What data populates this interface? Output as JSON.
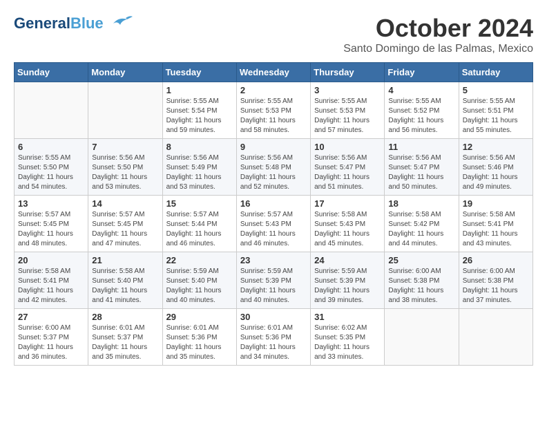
{
  "header": {
    "logo_line1": "General",
    "logo_line2": "Blue",
    "month_year": "October 2024",
    "location": "Santo Domingo de las Palmas, Mexico"
  },
  "weekdays": [
    "Sunday",
    "Monday",
    "Tuesday",
    "Wednesday",
    "Thursday",
    "Friday",
    "Saturday"
  ],
  "weeks": [
    [
      {
        "day": "",
        "info": ""
      },
      {
        "day": "",
        "info": ""
      },
      {
        "day": "1",
        "info": "Sunrise: 5:55 AM\nSunset: 5:54 PM\nDaylight: 11 hours\nand 59 minutes."
      },
      {
        "day": "2",
        "info": "Sunrise: 5:55 AM\nSunset: 5:53 PM\nDaylight: 11 hours\nand 58 minutes."
      },
      {
        "day": "3",
        "info": "Sunrise: 5:55 AM\nSunset: 5:53 PM\nDaylight: 11 hours\nand 57 minutes."
      },
      {
        "day": "4",
        "info": "Sunrise: 5:55 AM\nSunset: 5:52 PM\nDaylight: 11 hours\nand 56 minutes."
      },
      {
        "day": "5",
        "info": "Sunrise: 5:55 AM\nSunset: 5:51 PM\nDaylight: 11 hours\nand 55 minutes."
      }
    ],
    [
      {
        "day": "6",
        "info": "Sunrise: 5:55 AM\nSunset: 5:50 PM\nDaylight: 11 hours\nand 54 minutes."
      },
      {
        "day": "7",
        "info": "Sunrise: 5:56 AM\nSunset: 5:50 PM\nDaylight: 11 hours\nand 53 minutes."
      },
      {
        "day": "8",
        "info": "Sunrise: 5:56 AM\nSunset: 5:49 PM\nDaylight: 11 hours\nand 53 minutes."
      },
      {
        "day": "9",
        "info": "Sunrise: 5:56 AM\nSunset: 5:48 PM\nDaylight: 11 hours\nand 52 minutes."
      },
      {
        "day": "10",
        "info": "Sunrise: 5:56 AM\nSunset: 5:47 PM\nDaylight: 11 hours\nand 51 minutes."
      },
      {
        "day": "11",
        "info": "Sunrise: 5:56 AM\nSunset: 5:47 PM\nDaylight: 11 hours\nand 50 minutes."
      },
      {
        "day": "12",
        "info": "Sunrise: 5:56 AM\nSunset: 5:46 PM\nDaylight: 11 hours\nand 49 minutes."
      }
    ],
    [
      {
        "day": "13",
        "info": "Sunrise: 5:57 AM\nSunset: 5:45 PM\nDaylight: 11 hours\nand 48 minutes."
      },
      {
        "day": "14",
        "info": "Sunrise: 5:57 AM\nSunset: 5:45 PM\nDaylight: 11 hours\nand 47 minutes."
      },
      {
        "day": "15",
        "info": "Sunrise: 5:57 AM\nSunset: 5:44 PM\nDaylight: 11 hours\nand 46 minutes."
      },
      {
        "day": "16",
        "info": "Sunrise: 5:57 AM\nSunset: 5:43 PM\nDaylight: 11 hours\nand 46 minutes."
      },
      {
        "day": "17",
        "info": "Sunrise: 5:58 AM\nSunset: 5:43 PM\nDaylight: 11 hours\nand 45 minutes."
      },
      {
        "day": "18",
        "info": "Sunrise: 5:58 AM\nSunset: 5:42 PM\nDaylight: 11 hours\nand 44 minutes."
      },
      {
        "day": "19",
        "info": "Sunrise: 5:58 AM\nSunset: 5:41 PM\nDaylight: 11 hours\nand 43 minutes."
      }
    ],
    [
      {
        "day": "20",
        "info": "Sunrise: 5:58 AM\nSunset: 5:41 PM\nDaylight: 11 hours\nand 42 minutes."
      },
      {
        "day": "21",
        "info": "Sunrise: 5:58 AM\nSunset: 5:40 PM\nDaylight: 11 hours\nand 41 minutes."
      },
      {
        "day": "22",
        "info": "Sunrise: 5:59 AM\nSunset: 5:40 PM\nDaylight: 11 hours\nand 40 minutes."
      },
      {
        "day": "23",
        "info": "Sunrise: 5:59 AM\nSunset: 5:39 PM\nDaylight: 11 hours\nand 40 minutes."
      },
      {
        "day": "24",
        "info": "Sunrise: 5:59 AM\nSunset: 5:39 PM\nDaylight: 11 hours\nand 39 minutes."
      },
      {
        "day": "25",
        "info": "Sunrise: 6:00 AM\nSunset: 5:38 PM\nDaylight: 11 hours\nand 38 minutes."
      },
      {
        "day": "26",
        "info": "Sunrise: 6:00 AM\nSunset: 5:38 PM\nDaylight: 11 hours\nand 37 minutes."
      }
    ],
    [
      {
        "day": "27",
        "info": "Sunrise: 6:00 AM\nSunset: 5:37 PM\nDaylight: 11 hours\nand 36 minutes."
      },
      {
        "day": "28",
        "info": "Sunrise: 6:01 AM\nSunset: 5:37 PM\nDaylight: 11 hours\nand 35 minutes."
      },
      {
        "day": "29",
        "info": "Sunrise: 6:01 AM\nSunset: 5:36 PM\nDaylight: 11 hours\nand 35 minutes."
      },
      {
        "day": "30",
        "info": "Sunrise: 6:01 AM\nSunset: 5:36 PM\nDaylight: 11 hours\nand 34 minutes."
      },
      {
        "day": "31",
        "info": "Sunrise: 6:02 AM\nSunset: 5:35 PM\nDaylight: 11 hours\nand 33 minutes."
      },
      {
        "day": "",
        "info": ""
      },
      {
        "day": "",
        "info": ""
      }
    ]
  ]
}
